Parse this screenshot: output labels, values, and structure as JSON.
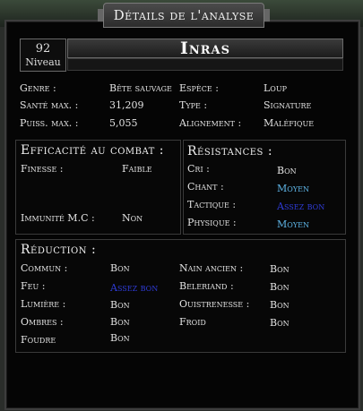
{
  "window": {
    "title": "Détails de l'analyse"
  },
  "header": {
    "level_value": "92",
    "level_label": "Niveau",
    "name": "Inras"
  },
  "stats": [
    {
      "label": "Genre :",
      "value": "Bête sauvage"
    },
    {
      "label": "Santé max. :",
      "value": "31,209"
    },
    {
      "label": "Puiss. max. :",
      "value": "5,055"
    }
  ],
  "stats_right": [
    {
      "label": "Espèce :",
      "value": "Loup"
    },
    {
      "label": "Type :",
      "value": "Signature"
    },
    {
      "label": "Alignement :",
      "value": "Maléfique"
    }
  ],
  "combat": {
    "title": "Efficacité au combat :",
    "finesse_label": "Finesse :",
    "finesse_value": "Faible",
    "immunity_label": "Immunité M.C :",
    "immunity_value": "Non"
  },
  "resistances": {
    "title": "Résistances :",
    "items": [
      {
        "label": "Cri :",
        "value": "Bon",
        "color": "#e2e2e2"
      },
      {
        "label": "Chant :",
        "value": "Moyen",
        "color": "#5fb6e8"
      },
      {
        "label": "Tactique :",
        "value": "Assez bon",
        "color": "#2f3cd8"
      },
      {
        "label": "Physique :",
        "value": "Moyen",
        "color": "#5fb6e8"
      }
    ]
  },
  "reduction": {
    "title": "Réduction :",
    "left": [
      {
        "label": "Commun :",
        "value": "Bon"
      },
      {
        "label": "Feu :",
        "value": "Assez bon"
      },
      {
        "label": "Lumière :",
        "value": "Bon"
      },
      {
        "label": "Ombres :",
        "value": "Bon"
      },
      {
        "label": "Foudre",
        "value": "Bon"
      }
    ],
    "right": [
      {
        "label": "Nain ancien :",
        "value": "Bon"
      },
      {
        "label": "Beleriand :",
        "value": "Bon"
      },
      {
        "label": "Ouistrenesse :",
        "value": "Bon"
      },
      {
        "label": "Froid",
        "value": "Bon"
      }
    ]
  },
  "colors": {
    "light_blue": "#5fb6e8",
    "dark_blue": "#2f3cd8"
  }
}
